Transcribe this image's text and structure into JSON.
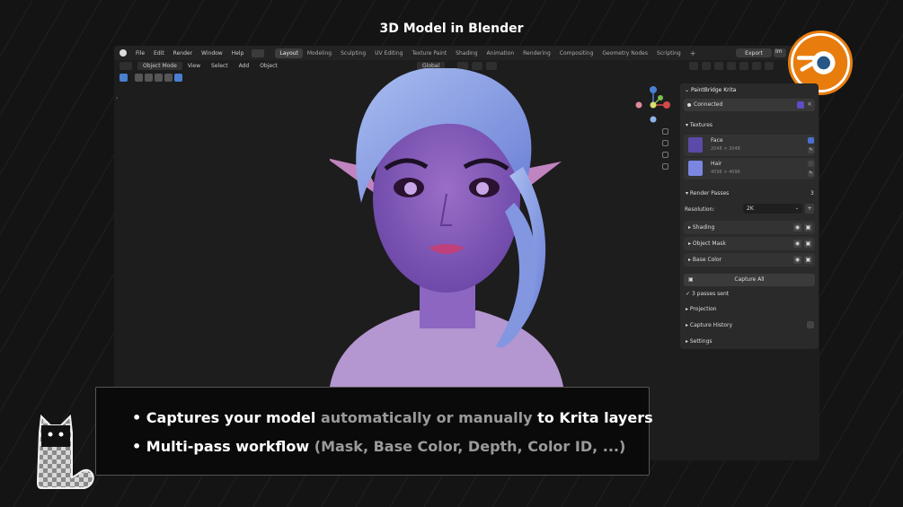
{
  "page": {
    "title": "3D Model in Blender"
  },
  "blender": {
    "menus": [
      "File",
      "Edit",
      "Render",
      "Window",
      "Help"
    ],
    "workspace_tabs": [
      "Layout",
      "Modeling",
      "Sculpting",
      "UV Editing",
      "Texture Paint",
      "Shading",
      "Animation",
      "Rendering",
      "Compositing",
      "Geometry Nodes",
      "Scripting"
    ],
    "active_tab": "Layout",
    "export_label": "Export",
    "export_secondary": "Im",
    "header": {
      "mode": "Object Mode",
      "menus": [
        "View",
        "Select",
        "Add",
        "Object"
      ],
      "transform_orientation": "Global"
    }
  },
  "addon": {
    "title": "PaintBridge Krita",
    "status": "Connected",
    "textures_header": "Textures",
    "textures": [
      {
        "name": "Face",
        "size": "2048 × 2048"
      },
      {
        "name": "Hair",
        "size": "4096 × 4096"
      }
    ],
    "render_passes_header": "Render Passes",
    "render_passes_count": "3",
    "resolution_label": "Resolution:",
    "resolution_value": "2K",
    "passes": [
      "Shading",
      "Object Mask",
      "Base Color"
    ],
    "capture_all_label": "Capture All",
    "passes_sent": "3 passes sent",
    "sections": [
      "Projection",
      "Capture History",
      "Settings"
    ]
  },
  "callout": {
    "bullet1": {
      "part1": "Captures your model",
      "part2": "automatically or manually",
      "part3": "to Krita layers"
    },
    "bullet2": {
      "part1": "Multi-pass workflow",
      "part2": "(Mask, Base Color, Depth, Color ID, ...)"
    }
  },
  "colors": {
    "blender_orange": "#e87d0d",
    "blender_blue": "#265787",
    "accent_blue": "#4a7fd0"
  }
}
